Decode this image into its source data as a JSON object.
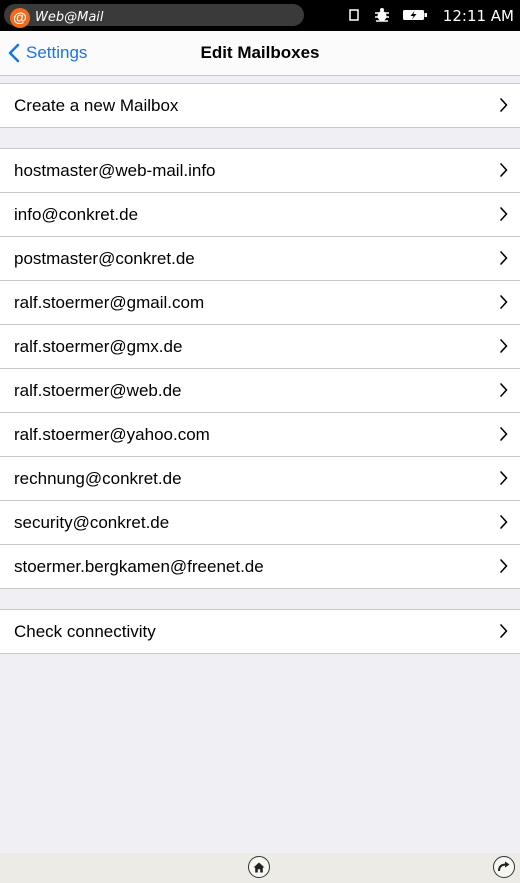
{
  "statusbar": {
    "app_name": "Web@Mail",
    "app_icon_glyph": "@",
    "time": "12:11 AM",
    "icons": [
      "screen-icon",
      "bug-icon",
      "battery-charging-icon"
    ]
  },
  "navbar": {
    "back_label": "Settings",
    "title": "Edit Mailboxes"
  },
  "create_group": {
    "label": "Create a new Mailbox"
  },
  "mailboxes": [
    "hostmaster@web-mail.info",
    "info@conkret.de",
    "postmaster@conkret.de",
    "ralf.stoermer@gmail.com",
    "ralf.stoermer@gmx.de",
    "ralf.stoermer@web.de",
    "ralf.stoermer@yahoo.com",
    "rechnung@conkret.de",
    "security@conkret.de",
    "stoermer.bergkamen@freenet.de"
  ],
  "check_group": {
    "label": "Check connectivity"
  },
  "colors": {
    "accent": "#1a73e8",
    "background": "#efeff4",
    "app_icon": "#f26a1b"
  },
  "bottombar": {
    "icons": [
      "home-icon",
      "forward-icon"
    ]
  }
}
